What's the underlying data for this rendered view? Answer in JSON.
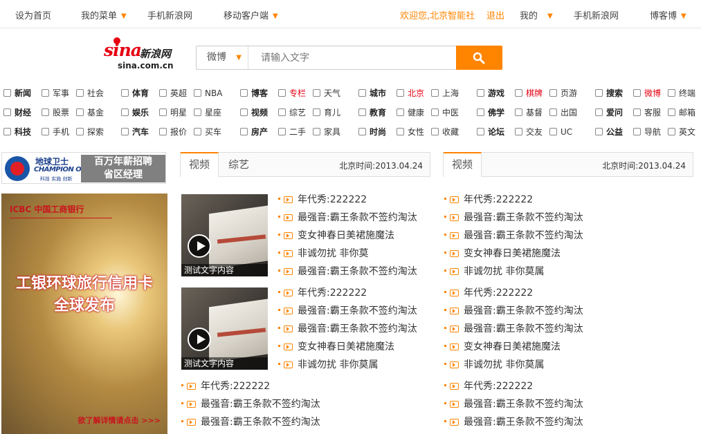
{
  "topbar": {
    "set_home": "设为首页",
    "my_menu": "我的菜单",
    "mobile_site": "手机新浪网",
    "mobile_client": "移动客户端",
    "welcome": "欢迎您,北京智能社",
    "logout": "退出",
    "mine": "我的",
    "mobile_site_right": "手机新浪网",
    "blog": "博客博"
  },
  "logo": {
    "sina": "sina",
    "cn": "新浪网",
    "domain": "sina.com.cn"
  },
  "search": {
    "category": "微博",
    "placeholder": "请输入文字"
  },
  "nav": [
    [
      [
        "新闻",
        "军事",
        "社会"
      ],
      [
        "财经",
        "股票",
        "基金"
      ],
      [
        "科技",
        "手机",
        "探索"
      ]
    ],
    [
      [
        "体育",
        "英超",
        "NBA"
      ],
      [
        "娱乐",
        "明星",
        "星座"
      ],
      [
        "汽车",
        "报价",
        "买车"
      ]
    ],
    [
      [
        "博客",
        "专栏",
        "天气"
      ],
      [
        "视频",
        "综艺",
        "育儿"
      ],
      [
        "房产",
        "二手",
        "家具"
      ]
    ],
    [
      [
        "城市",
        "北京",
        "上海"
      ],
      [
        "教育",
        "健康",
        "中医"
      ],
      [
        "时尚",
        "女性",
        "收藏"
      ]
    ],
    [
      [
        "游戏",
        "棋牌",
        "页游"
      ],
      [
        "佛学",
        "基督",
        "出国"
      ],
      [
        "论坛",
        "交友",
        "UC"
      ]
    ],
    [
      [
        "搜索",
        "微博",
        "终端"
      ],
      [
        "爱问",
        "客服",
        "邮箱"
      ],
      [
        "公益",
        "导航",
        "英文"
      ]
    ]
  ],
  "ads": {
    "ad1": {
      "line1": "地球卫士",
      "line2": "CHAMPION OF THE EARTH",
      "line3": "科技 实施 创新",
      "panel_1": "百万年薪招聘",
      "panel_2": "省区经理"
    },
    "ad2": {
      "bank": "ICBC 中国工商银行",
      "headline_1": "工银环球旅行信用卡",
      "headline_2": "全球发布",
      "more": "欲了解详情请点击 >>>"
    }
  },
  "panel_left": {
    "tabs": [
      "视频",
      "综艺"
    ],
    "time": "北京时间:2013.04.24",
    "caption": "测试文字内容",
    "list_a": [
      "年代秀:222222",
      "最强音:霸王条款不签约淘汰",
      "变女神春日美裙施魔法",
      "非诚勿扰 非你莫",
      "最强音:霸王条款不签约淘汰"
    ],
    "list_b": [
      "年代秀:222222",
      "最强音:霸王条款不签约淘汰",
      "最强音:霸王条款不签约淘汰",
      "变女神春日美裙施魔法",
      "非诚勿扰 非你莫属"
    ],
    "list_c": [
      "年代秀:222222",
      "最强音:霸王条款不签约淘汰",
      "最强音:霸王条款不签约淘汰"
    ]
  },
  "panel_right": {
    "tabs": [
      "视频"
    ],
    "time": "北京时间:2013.04.24",
    "list": [
      "年代秀:222222",
      "最强音:霸王条款不签约淘汰",
      "最强音:霸王条款不签约淘汰",
      "变女神春日美裙施魔法",
      "非诚勿扰 非你莫属",
      "年代秀:222222",
      "最强音:霸王条款不签约淘汰",
      "最强音:霸王条款不签约淘汰",
      "变女神春日美裙施魔法",
      "非诚勿扰 非你莫属",
      "年代秀:222222",
      "最强音:霸王条款不签约淘汰",
      "最强音:霸王条款不签约淘汰"
    ]
  },
  "colors": {
    "accent": "#ff8400",
    "brand_red": "#e60012"
  }
}
